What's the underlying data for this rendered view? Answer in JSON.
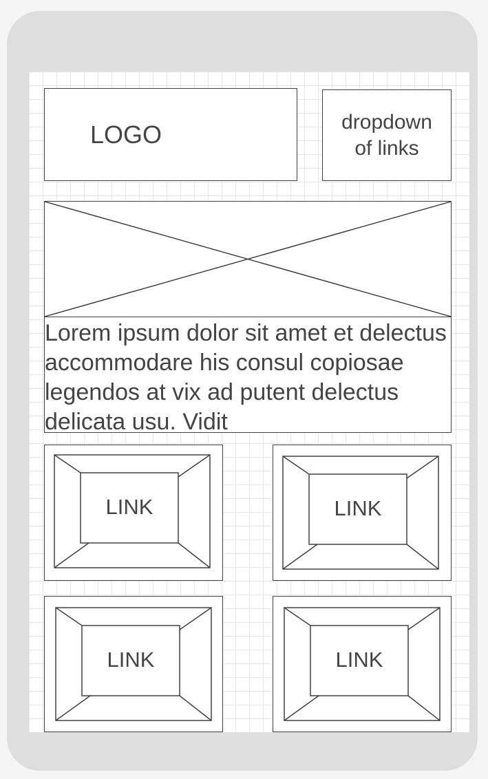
{
  "header": {
    "logo_text": "LOGO",
    "dropdown_text": "dropdown of links"
  },
  "hero": {
    "image_placeholder": "image-placeholder"
  },
  "body_text": "Lorem ipsum dolor sit amet et delectus accommodare his consul copiosae legendos at vix ad putent delectus delicata usu. Vidit",
  "links": [
    {
      "label": "LINK"
    },
    {
      "label": "LINK"
    },
    {
      "label": "LINK"
    },
    {
      "label": "LINK"
    }
  ],
  "colors": {
    "stroke": "#404040",
    "frame": "#dedede",
    "grid": "#e6e6e6"
  }
}
